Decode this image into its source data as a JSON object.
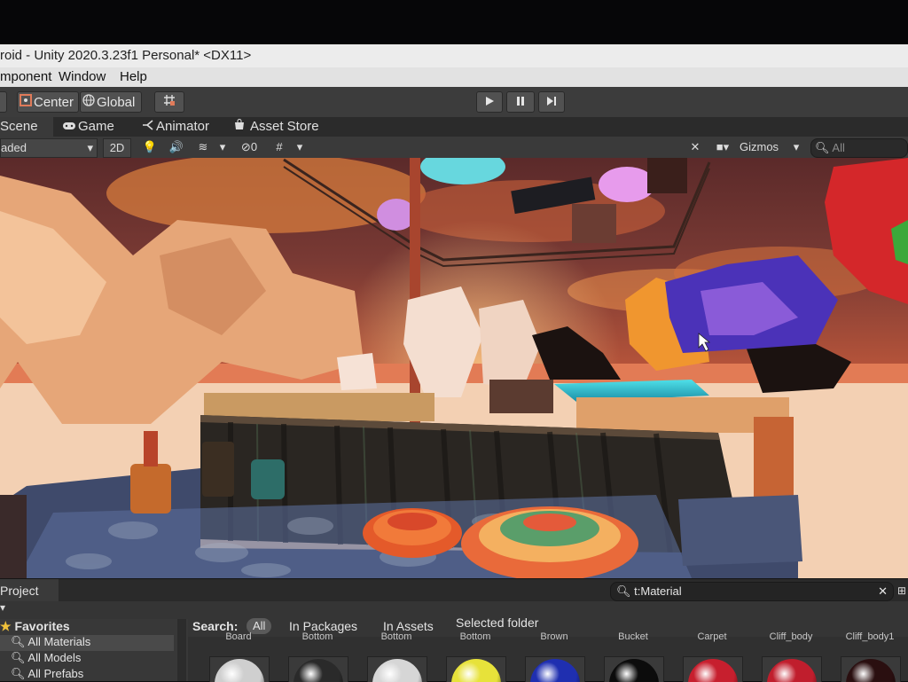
{
  "window": {
    "title": "roid - Unity 2020.3.23f1 Personal* <DX11>"
  },
  "menu": {
    "items": [
      "mponent",
      "Window",
      "Help"
    ]
  },
  "toolbar": {
    "center_label": "Center",
    "global_label": "Global"
  },
  "tabs": [
    {
      "label": "Scene",
      "icon": "scene-icon"
    },
    {
      "label": "Game",
      "icon": "gamepad-icon"
    },
    {
      "label": "Animator",
      "icon": "animator-icon"
    },
    {
      "label": "Asset Store",
      "icon": "store-icon"
    }
  ],
  "scene_toolbar": {
    "shading_mode": "aded",
    "mode_2d": "2D",
    "hidden_count": "0",
    "gizmos_label": "Gizmos",
    "search_placeholder": "All"
  },
  "project": {
    "tab_label": "Project",
    "search_value": "t:Material",
    "favorites_label": "Favorites",
    "favorites": [
      "All Materials",
      "All Models",
      "All Prefabs"
    ],
    "search_label": "Search:",
    "filters": [
      "All",
      "In Packages",
      "In Assets",
      "Selected folder"
    ],
    "active_filter": "All",
    "asset_labels": [
      "Board",
      "Bottom",
      "Bottom",
      "Bottom",
      "Brown",
      "Bucket",
      "Carpet",
      "Cliff_body",
      "Cliff_body1"
    ],
    "asset_colors": [
      "#cfcfcf",
      "#2a2a2a",
      "#d6d6d6",
      "#e7e23a",
      "#1f2fb0",
      "#0c0c0c",
      "#c71f2e",
      "#c01e2d",
      "#2a0f10"
    ]
  }
}
